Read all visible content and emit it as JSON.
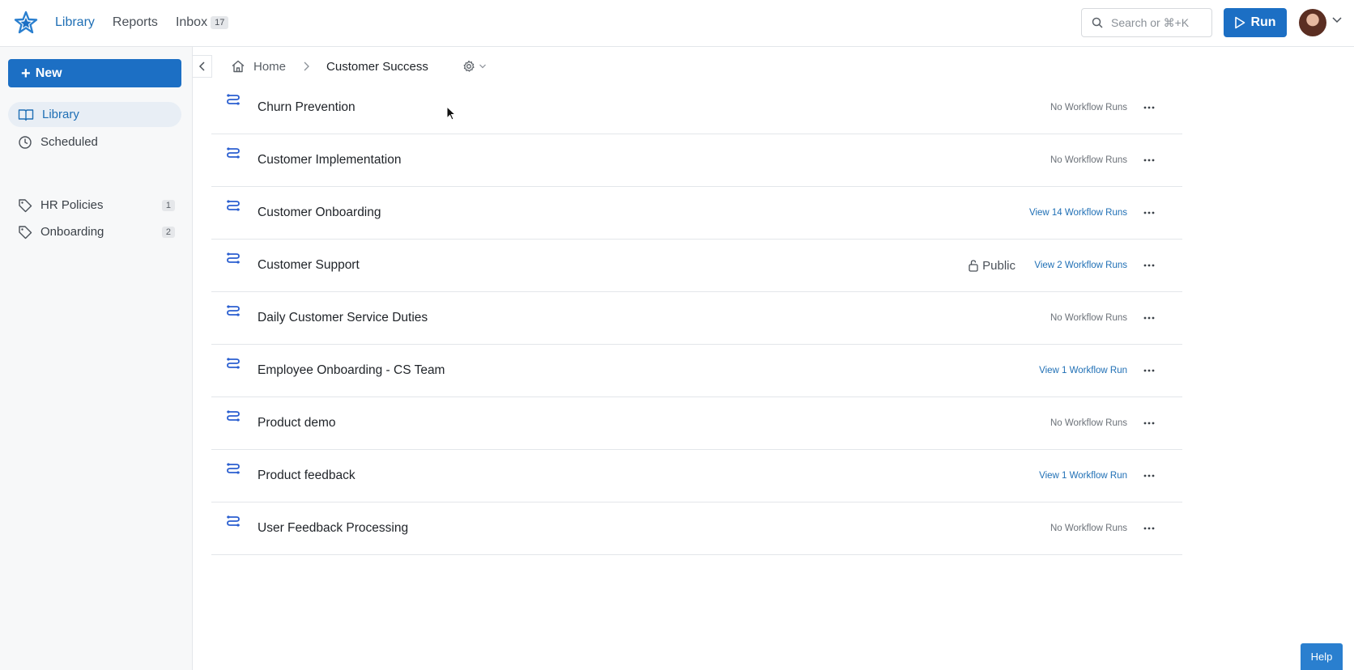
{
  "topnav": {
    "items": [
      {
        "label": "Library",
        "active": true
      },
      {
        "label": "Reports",
        "active": false
      },
      {
        "label": "Inbox",
        "active": false,
        "badge": "17"
      }
    ],
    "search_placeholder": "Search or ⌘+K",
    "run_label": "Run"
  },
  "sidebar": {
    "new_label": "New",
    "nav": [
      {
        "label": "Library",
        "icon": "book-icon",
        "active": true
      },
      {
        "label": "Scheduled",
        "icon": "clock-icon",
        "active": false
      }
    ],
    "tags": [
      {
        "label": "HR Policies",
        "count": "1"
      },
      {
        "label": "Onboarding",
        "count": "2"
      }
    ]
  },
  "breadcrumb": {
    "home": "Home",
    "current": "Customer Success"
  },
  "workflows": [
    {
      "name": "Churn Prevention",
      "runs": "No Workflow Runs",
      "link": false,
      "public": ""
    },
    {
      "name": "Customer Implementation",
      "runs": "No Workflow Runs",
      "link": false,
      "public": ""
    },
    {
      "name": "Customer Onboarding",
      "runs": "View 14 Workflow Runs",
      "link": true,
      "public": ""
    },
    {
      "name": "Customer Support",
      "runs": "View 2 Workflow Runs",
      "link": true,
      "public": "Public"
    },
    {
      "name": "Daily Customer Service Duties",
      "runs": "No Workflow Runs",
      "link": false,
      "public": ""
    },
    {
      "name": "Employee Onboarding - CS Team",
      "runs": "View 1 Workflow Run",
      "link": true,
      "public": ""
    },
    {
      "name": "Product demo",
      "runs": "No Workflow Runs",
      "link": false,
      "public": ""
    },
    {
      "name": "Product feedback",
      "runs": "View 1 Workflow Run",
      "link": true,
      "public": ""
    },
    {
      "name": "User Feedback Processing",
      "runs": "No Workflow Runs",
      "link": false,
      "public": ""
    }
  ],
  "help_label": "Help",
  "colors": {
    "accent": "#1c6fc4",
    "link": "#1f6fb5",
    "workflow_icon": "#2b5fd0"
  }
}
